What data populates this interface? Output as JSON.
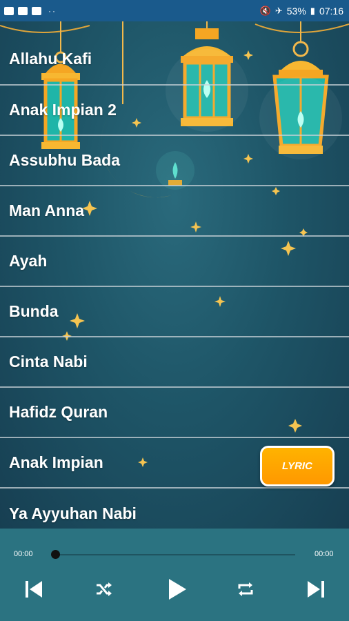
{
  "status_bar": {
    "battery": "53%",
    "time": "07:16",
    "dots": "··",
    "icons": [
      "youtube-icon",
      "flipboard-icon",
      "youtube-icon",
      "mute-icon",
      "airplane-icon",
      "battery-icon"
    ]
  },
  "songs": [
    "Allahu Kafi",
    "Anak Impian 2",
    "Assubhu Bada",
    "Man Anna",
    "Ayah",
    "Bunda",
    "Cinta Nabi",
    "Hafidz Quran",
    "Anak Impian",
    "Ya Ayyuhan Nabi"
  ],
  "lyric_button": "LYRIC",
  "player": {
    "current_time": "00:00",
    "duration": "00:00",
    "progress": 0,
    "controls": [
      "previous-icon",
      "shuffle-icon",
      "play-icon",
      "repeat-icon",
      "next-icon"
    ]
  },
  "colors": {
    "status_bar": "#1a5a8c",
    "background": "#1c4e60",
    "accent": "#ffa000",
    "player_bar": "#2b7381"
  }
}
